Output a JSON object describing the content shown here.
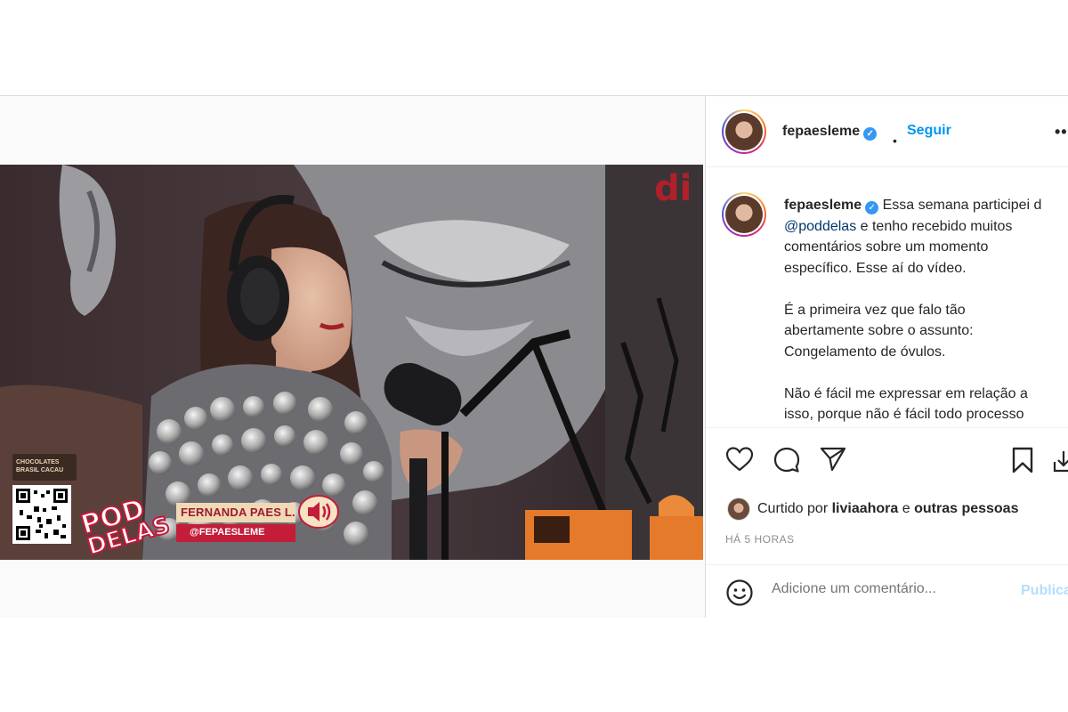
{
  "post": {
    "author": {
      "username": "fepaesleme",
      "verified_glyph": "✓",
      "separator": "•",
      "follow_label": "Seguir",
      "more_glyph": "•••"
    },
    "caption": {
      "username": "fepaesleme",
      "line1": "Essa semana participei d",
      "mention": "@poddelas",
      "line2_rest": " e tenho recebido muitos",
      "line3": "comentários sobre um momento",
      "line4": "específico. Esse aí do vídeo.",
      "para2_line1": "É a primeira vez que falo tão",
      "para2_line2": "abertamente sobre o assunto:",
      "para2_line3": "Congelamento de óvulos.",
      "para3_line1": "Não é fácil me expressar em relação a",
      "para3_line2": "isso, porque não é fácil todo processo"
    },
    "actions": {
      "like_icon": "heart-icon",
      "comment_icon": "comment-icon",
      "share_icon": "send-icon",
      "save_icon": "bookmark-icon"
    },
    "likes": {
      "prefix": "Curtido por ",
      "user": "liviaahora",
      "connector": " e ",
      "others": "outras pessoas"
    },
    "time_ago": "HÁ 5 HORAS",
    "comment_box": {
      "placeholder": "Adicione um comentário...",
      "publish_label": "Publicar"
    }
  },
  "video_overlay": {
    "brand_line1": "CHOCOLATES",
    "brand_line2": "BRASIL CACAU",
    "logo_top": "POD",
    "logo_bottom": "DELAS",
    "guest_name": "FERNANDA PAES L.",
    "guest_handle": "@FEPAESLEME"
  },
  "colors": {
    "accent_blue": "#0095f6",
    "publish_disabled": "#b2dffc",
    "brand_red": "#c31d3a"
  }
}
